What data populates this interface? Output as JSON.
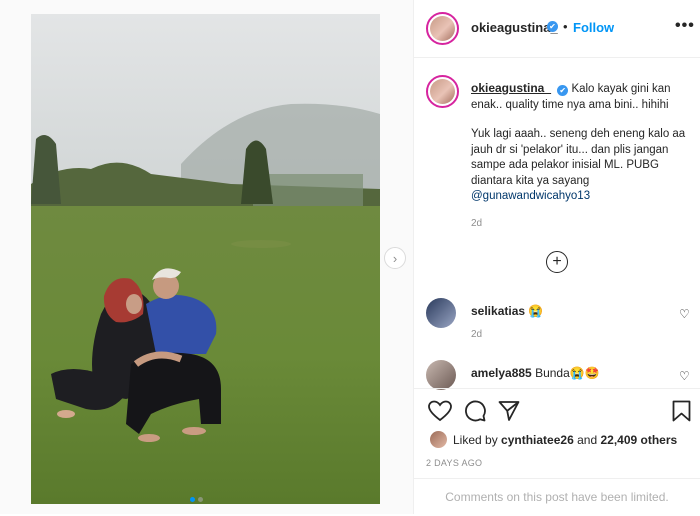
{
  "post": {
    "username": "okieagustina_",
    "follow_label": "Follow",
    "more_label": "•••",
    "caption_line1": "Kalo kayak gini kan enak.. quality time nya ama bini.. hihihi",
    "caption_line2": "Yuk lagi aaah.. seneng deh eneng kalo aa jauh dr si 'pelakor' itu... dan plis jangan sampe ada pelakor inisial ML. PUBG diantara kita ya sayang",
    "caption_mention": "@gunawandwicahyo13",
    "caption_time": "2d",
    "load_more": "+"
  },
  "comments": [
    {
      "username": "selikatias",
      "text": "😭",
      "time": "2d"
    },
    {
      "username": "amelya885",
      "text": "Bunda😭🤩",
      "time": ""
    }
  ],
  "likes": {
    "prefix": "Liked by",
    "first_user": "cynthiatee26",
    "joiner": "and",
    "others": "22,409 others"
  },
  "date_label": "2 DAYS AGO",
  "comments_limited": "Comments on this post have been limited.",
  "icons": [
    "verified-badge-icon",
    "more-options-icon",
    "next-arrow-icon",
    "add-circle-icon",
    "heart-icon",
    "comment-icon",
    "share-icon",
    "bookmark-icon"
  ],
  "colors": {
    "accent": "#0095f6",
    "verified": "#3897f0",
    "text": "#262626",
    "muted": "#8e8e8e"
  }
}
